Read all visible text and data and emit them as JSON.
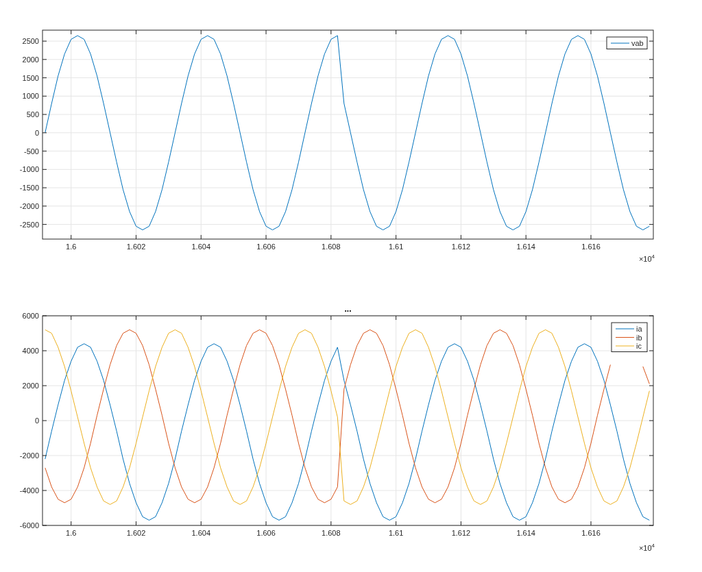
{
  "figure": {
    "plots": [
      {
        "chart_data": {
          "type": "line",
          "xlabel": "×10$^{4}$",
          "x": [
            1.5992,
            1.5994,
            1.5996,
            1.5998,
            1.6,
            1.6002,
            1.6004,
            1.6006,
            1.6008,
            1.601,
            1.6012,
            1.6014,
            1.6016,
            1.6018,
            1.602,
            1.6022,
            1.6024,
            1.6026,
            1.6028,
            1.603,
            1.6032,
            1.6034,
            1.6036,
            1.6038,
            1.604,
            1.6042,
            1.6044,
            1.6046,
            1.6048,
            1.605,
            1.6052,
            1.6054,
            1.6056,
            1.6058,
            1.606,
            1.6062,
            1.6064,
            1.6066,
            1.6068,
            1.607,
            1.6072,
            1.6074,
            1.6076,
            1.6078,
            1.608,
            1.6082,
            1.6084,
            1.6086,
            1.6088,
            1.609,
            1.6092,
            1.6094,
            1.6096,
            1.6098,
            1.61,
            1.6102,
            1.6104,
            1.6106,
            1.6108,
            1.611,
            1.6112,
            1.6114,
            1.6116,
            1.6118,
            1.612,
            1.6122,
            1.6124,
            1.6126,
            1.6128,
            1.613,
            1.6132,
            1.6134,
            1.6136,
            1.6138,
            1.614,
            1.6142,
            1.6144,
            1.6146,
            1.6148,
            1.615,
            1.6152,
            1.6154,
            1.6156,
            1.6158,
            1.616,
            1.6162,
            1.6164,
            1.6166,
            1.6168,
            1.617,
            1.6172,
            1.6174,
            1.6176,
            1.6178
          ],
          "series": [
            {
              "name": "vab",
              "color": "#0072bd",
              "values": [
                0,
                800,
                1550,
                2150,
                2550,
                2650,
                2550,
                2150,
                1550,
                800,
                0,
                -800,
                -1550,
                -2150,
                -2550,
                -2650,
                -2550,
                -2150,
                -1550,
                -800,
                0,
                800,
                1550,
                2150,
                2550,
                2650,
                2550,
                2150,
                1550,
                800,
                0,
                -800,
                -1550,
                -2150,
                -2550,
                -2650,
                -2550,
                -2150,
                -1550,
                -800,
                0,
                800,
                1550,
                2150,
                2550,
                2650,
                800,
                0,
                -800,
                -1550,
                -2150,
                -2550,
                -2650,
                -2550,
                -2150,
                -1550,
                -800,
                0,
                800,
                1550,
                2150,
                2550,
                2650,
                2550,
                2150,
                1550,
                800,
                0,
                -800,
                -1550,
                -2150,
                -2550,
                -2650,
                -2550,
                -2150,
                -1550,
                -800,
                0,
                800,
                1550,
                2150,
                2550,
                2650,
                2550,
                2150,
                1550,
                800,
                0,
                -800,
                -1550,
                -2150,
                -2550,
                -2650,
                -2550
              ]
            }
          ],
          "xlim": [
            1.59912,
            1.61792
          ],
          "ylim": [
            -2900,
            2800
          ],
          "xticks": [
            {
              "value": 1.6,
              "label": "1.6"
            },
            {
              "value": 1.602,
              "label": "1.602"
            },
            {
              "value": 1.604,
              "label": "1.604"
            },
            {
              "value": 1.606,
              "label": "1.606"
            },
            {
              "value": 1.608,
              "label": "1.608"
            },
            {
              "value": 1.61,
              "label": "1.61"
            },
            {
              "value": 1.612,
              "label": "1.612"
            },
            {
              "value": 1.614,
              "label": "1.614"
            },
            {
              "value": 1.616,
              "label": "1.616"
            }
          ],
          "yticks": [
            -2500,
            -2000,
            -1500,
            -1000,
            -500,
            0,
            500,
            1000,
            1500,
            2000,
            2500
          ],
          "grid": true,
          "legend": true
        }
      },
      {
        "chart_data": {
          "type": "line",
          "title": "...",
          "xlabel": "×10$^{4}$",
          "x": [
            1.5992,
            1.5994,
            1.5996,
            1.5998,
            1.6,
            1.6002,
            1.6004,
            1.6006,
            1.6008,
            1.601,
            1.6012,
            1.6014,
            1.6016,
            1.6018,
            1.602,
            1.6022,
            1.6024,
            1.6026,
            1.6028,
            1.603,
            1.6032,
            1.6034,
            1.6036,
            1.6038,
            1.604,
            1.6042,
            1.6044,
            1.6046,
            1.6048,
            1.605,
            1.6052,
            1.6054,
            1.6056,
            1.6058,
            1.606,
            1.6062,
            1.6064,
            1.6066,
            1.6068,
            1.607,
            1.6072,
            1.6074,
            1.6076,
            1.6078,
            1.608,
            1.6082,
            1.6084,
            1.6086,
            1.6088,
            1.609,
            1.6092,
            1.6094,
            1.6096,
            1.6098,
            1.61,
            1.6102,
            1.6104,
            1.6106,
            1.6108,
            1.611,
            1.6112,
            1.6114,
            1.6116,
            1.6118,
            1.612,
            1.6122,
            1.6124,
            1.6126,
            1.6128,
            1.613,
            1.6132,
            1.6134,
            1.6136,
            1.6138,
            1.614,
            1.6142,
            1.6144,
            1.6146,
            1.6148,
            1.615,
            1.6152,
            1.6154,
            1.6156,
            1.6158,
            1.616,
            1.6162,
            1.6164,
            1.6166,
            1.6168,
            1.617,
            1.6172,
            1.6174,
            1.6176,
            1.6178
          ],
          "series": [
            {
              "name": "ia",
              "color": "#0072bd",
              "values": [
                -2200,
                -600,
                900,
                2300,
                3400,
                4200,
                4400,
                4200,
                3400,
                2300,
                900,
                -600,
                -2200,
                -3600,
                -4700,
                -5500,
                -5700,
                -5500,
                -4700,
                -3600,
                -2200,
                -600,
                900,
                2300,
                3400,
                4200,
                4400,
                4200,
                3400,
                2300,
                900,
                -600,
                -2200,
                -3600,
                -4700,
                -5500,
                -5700,
                -5500,
                -4700,
                -3600,
                -2200,
                -600,
                900,
                2300,
                3400,
                4200,
                2300,
                900,
                -600,
                -2200,
                -3600,
                -4700,
                -5500,
                -5700,
                -5500,
                -4700,
                -3600,
                -2200,
                -600,
                900,
                2300,
                3400,
                4200,
                4400,
                4200,
                3400,
                2300,
                900,
                -600,
                -2200,
                -3600,
                -4700,
                -5500,
                -5700,
                -5500,
                -4700,
                -3600,
                -2200,
                -600,
                900,
                2300,
                3400,
                4200,
                4400,
                4200,
                3400,
                2300,
                900,
                -600,
                -2200,
                -3600,
                -4700,
                -5500,
                -5700
              ]
            },
            {
              "name": "ib",
              "color": "#d95319",
              "values": [
                -2700,
                -3800,
                -4500,
                -4700,
                -4500,
                -3800,
                -2700,
                -1300,
                300,
                1800,
                3200,
                4300,
                5000,
                5200,
                5000,
                4300,
                3200,
                1800,
                300,
                -1300,
                -2700,
                -3800,
                -4500,
                -4700,
                -4500,
                -3800,
                -2700,
                -1300,
                300,
                1800,
                3200,
                4300,
                5000,
                5200,
                5000,
                4300,
                3200,
                1800,
                300,
                -1300,
                -2700,
                -3800,
                -4500,
                -4700,
                -4500,
                -3800,
                1800,
                3200,
                4300,
                5000,
                5200,
                5000,
                4300,
                3200,
                1800,
                300,
                -1300,
                -2700,
                -3800,
                -4500,
                -4700,
                -4500,
                -3800,
                -2700,
                -1300,
                300,
                1800,
                3200,
                4300,
                5000,
                5200,
                5000,
                4300,
                3200,
                1800,
                300,
                -1300,
                -2700,
                -3800,
                -4500,
                -4700,
                -4500,
                -3800,
                -2700,
                -1300,
                300,
                1800,
                3200,
                null,
                null,
                null,
                null,
                3100,
                2100
              ]
            },
            {
              "name": "ic",
              "color": "#edb120",
              "values": [
                5200,
                5000,
                4200,
                3100,
                1700,
                200,
                -1300,
                -2700,
                -3800,
                -4600,
                -4800,
                -4600,
                -3800,
                -2700,
                -1300,
                200,
                1700,
                3100,
                4200,
                5000,
                5200,
                5000,
                4200,
                3100,
                1700,
                200,
                -1300,
                -2700,
                -3800,
                -4600,
                -4800,
                -4600,
                -3800,
                -2700,
                -1300,
                200,
                1700,
                3100,
                4200,
                5000,
                5200,
                5000,
                4200,
                3100,
                1700,
                200,
                -4600,
                -4800,
                -4600,
                -3800,
                -2700,
                -1300,
                200,
                1700,
                3100,
                4200,
                5000,
                5200,
                5000,
                4200,
                3100,
                1700,
                200,
                -1300,
                -2700,
                -3800,
                -4600,
                -4800,
                -4600,
                -3800,
                -2700,
                -1300,
                200,
                1700,
                3100,
                4200,
                5000,
                5200,
                5000,
                4200,
                3100,
                1700,
                200,
                -1300,
                -2700,
                -3800,
                -4600,
                -4800,
                -4600,
                -3800,
                -2700,
                -1300,
                200,
                1700
              ]
            }
          ],
          "xlim": [
            1.59912,
            1.61792
          ],
          "ylim": [
            -6000,
            6000
          ],
          "xticks": [
            {
              "value": 1.6,
              "label": "1.6"
            },
            {
              "value": 1.602,
              "label": "1.602"
            },
            {
              "value": 1.604,
              "label": "1.604"
            },
            {
              "value": 1.606,
              "label": "1.606"
            },
            {
              "value": 1.608,
              "label": "1.608"
            },
            {
              "value": 1.61,
              "label": "1.61"
            },
            {
              "value": 1.612,
              "label": "1.612"
            },
            {
              "value": 1.614,
              "label": "1.614"
            },
            {
              "value": 1.616,
              "label": "1.616"
            }
          ],
          "yticks": [
            -6000,
            -4000,
            -2000,
            0,
            2000,
            4000,
            6000
          ],
          "grid": true,
          "legend": true
        }
      }
    ]
  }
}
